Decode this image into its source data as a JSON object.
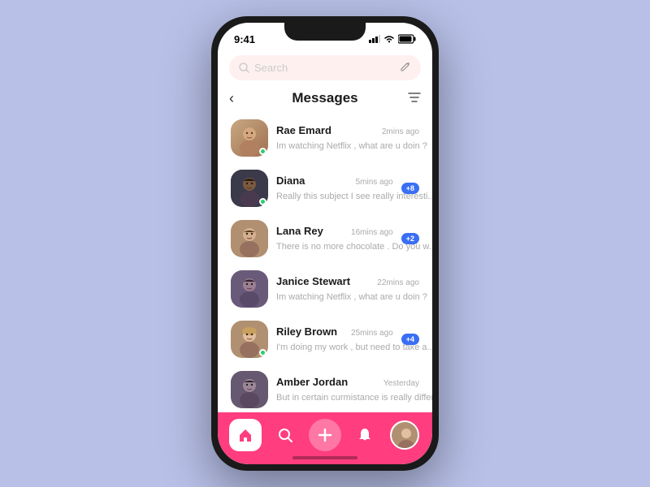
{
  "phone": {
    "status": {
      "time": "9:41",
      "signal": "▂▄▆",
      "wifi": "WiFi",
      "battery": "🔋"
    },
    "search": {
      "placeholder": "Search",
      "compose_icon": "✏"
    },
    "header": {
      "title": "Messages",
      "back_label": "‹",
      "filter_label": "⊳"
    },
    "messages": [
      {
        "id": 1,
        "name": "Rae Emard",
        "time": "2mins ago",
        "preview": "Im watching Netflix , what are u doin ?",
        "online": true,
        "badge": null,
        "avatar_color1": "#c8a882",
        "avatar_color2": "#a07050"
      },
      {
        "id": 2,
        "name": "Diana",
        "time": "5mins ago",
        "preview": "Really this subject I see really interesti...",
        "online": true,
        "badge": "+8",
        "avatar_color1": "#3a3a4a",
        "avatar_color2": "#555"
      },
      {
        "id": 3,
        "name": "Lana Rey",
        "time": "16mins ago",
        "preview": "There is no more chocolate . Do you w...",
        "online": false,
        "badge": "+2",
        "avatar_color1": "#c0a090",
        "avatar_color2": "#907060"
      },
      {
        "id": 4,
        "name": "Janice Stewart",
        "time": "22mins ago",
        "preview": "Im watching Netflix , what are u doin ?",
        "online": false,
        "badge": null,
        "avatar_color1": "#8a7a8a",
        "avatar_color2": "#6a5a7a"
      },
      {
        "id": 5,
        "name": "Riley Brown",
        "time": "25mins ago",
        "preview": "I'm doing my work , but need to take a...",
        "online": true,
        "badge": "+4",
        "avatar_color1": "#d4b896",
        "avatar_color2": "#b09070"
      },
      {
        "id": 6,
        "name": "Amber Jordan",
        "time": "Yesterday",
        "preview": "But in certain curmistance is really differ...",
        "online": false,
        "badge": null,
        "avatar_color1": "#888090",
        "avatar_color2": "#665870"
      }
    ],
    "nav": {
      "home": "⌂",
      "search": "⊙",
      "add": "+",
      "bell": "🔔"
    }
  }
}
